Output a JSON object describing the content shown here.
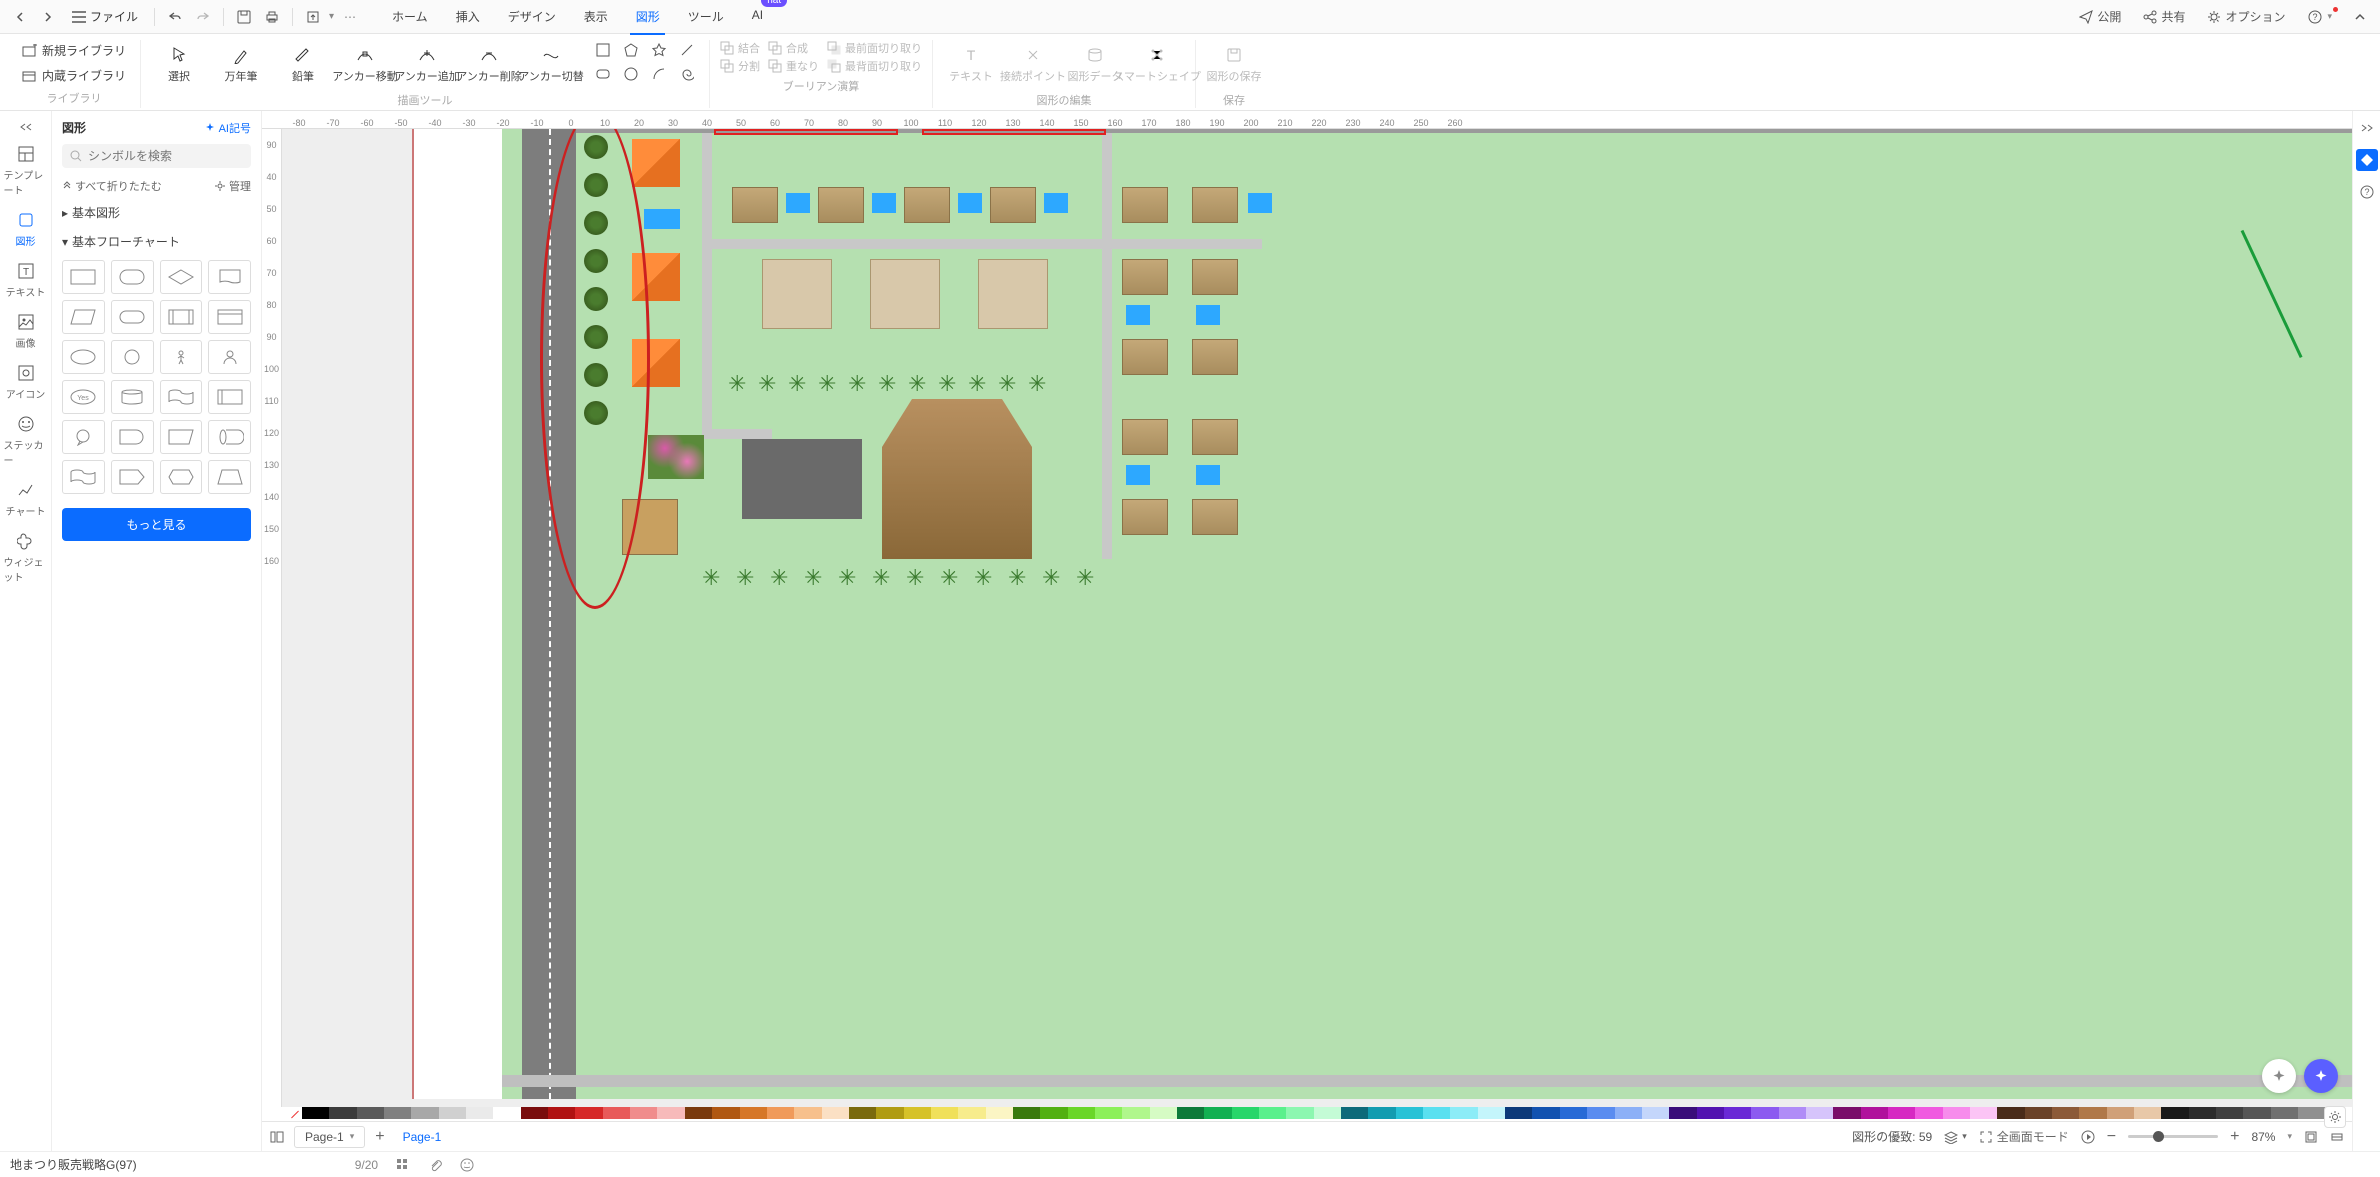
{
  "menubar": {
    "file": "ファイル",
    "items": [
      "ホーム",
      "挿入",
      "デザイン",
      "表示",
      "図形",
      "ツール",
      "AI"
    ],
    "active_index": 4,
    "hat_badge": "hat",
    "right": {
      "publish": "公開",
      "share": "共有",
      "options": "オプション"
    }
  },
  "ribbon": {
    "library": {
      "new": "新規ライブラリ",
      "builtin": "内蔵ライブラリ",
      "group_label": "ライブラリ"
    },
    "draw": {
      "select": "選択",
      "brush": "万年筆",
      "pencil": "鉛筆",
      "anchor_move": "アンカー移動",
      "anchor_add": "アンカー追加",
      "anchor_del": "アンカー削除",
      "anchor_toggle": "アンカー切替",
      "group_label": "描画ツール"
    },
    "boolean": {
      "union": "結合",
      "compose": "合成",
      "front_clip": "最前面切り取り",
      "split": "分割",
      "overlap": "重なり",
      "back_clip": "最背面切り取り",
      "group_label": "ブーリアン演算"
    },
    "edit": {
      "text": "テキスト",
      "connect": "接続ポイント",
      "data": "図形データ",
      "smart": "スマートシェイプ",
      "group_label": "図形の編集"
    },
    "save": {
      "save_shape": "図形の保存",
      "group_label": "保存"
    }
  },
  "left_rail": {
    "items": [
      {
        "label": "テンプレート"
      },
      {
        "label": "図形"
      },
      {
        "label": "テキスト"
      },
      {
        "label": "画像"
      },
      {
        "label": "アイコン"
      },
      {
        "label": "ステッカー"
      },
      {
        "label": "チャート"
      },
      {
        "label": "ウィジェット"
      }
    ],
    "active_index": 1
  },
  "shapes_panel": {
    "title": "図形",
    "ai_link": "AI記号",
    "search_placeholder": "シンボルを検索",
    "collapse_all": "すべて折りたたむ",
    "manage": "管理",
    "sections": {
      "basic_shapes": "基本図形",
      "basic_flow": "基本フローチャート"
    },
    "more": "もっと見る"
  },
  "ruler_h": [
    "-80",
    "-70",
    "-60",
    "-50",
    "-40",
    "-30",
    "-20",
    "-10",
    "0",
    "10",
    "20",
    "30",
    "40",
    "50",
    "60",
    "70",
    "80",
    "90",
    "100",
    "110",
    "120",
    "130",
    "140",
    "150",
    "160",
    "170",
    "180",
    "190",
    "200",
    "210",
    "220",
    "230",
    "240",
    "250",
    "260"
  ],
  "ruler_v": [
    "90",
    "40",
    "50",
    "60",
    "70",
    "80",
    "90",
    "100",
    "110",
    "120",
    "130",
    "140",
    "150",
    "160"
  ],
  "statusbar": {
    "page_dd": "Page-1",
    "page_tab": "Page-1",
    "priority_label": "図形の優致:",
    "priority_value": "59",
    "fullscreen": "全画面モード",
    "zoom_pct": "87%"
  },
  "footer": {
    "doc_name": "地まつり販売戦略G(97)",
    "counter": "9/20"
  },
  "palette": [
    "#000000",
    "#3b3b3b",
    "#5a5a5a",
    "#808080",
    "#a8a8a8",
    "#d0d0d0",
    "#eaeaea",
    "#ffffff",
    "#7a0d0d",
    "#b01212",
    "#d62828",
    "#e85a5a",
    "#f08c8c",
    "#f7baba",
    "#7a3a0d",
    "#b05812",
    "#d67728",
    "#f09a5a",
    "#f7c08c",
    "#fbe0c4",
    "#7a6a0d",
    "#b09c12",
    "#d6c228",
    "#f0e05a",
    "#f7ec8c",
    "#fbf5c4",
    "#3a7a0d",
    "#52b012",
    "#6ad628",
    "#8cf05a",
    "#b0f78c",
    "#d6fbc4",
    "#0d7a3a",
    "#12b052",
    "#28d66a",
    "#5af08c",
    "#8cf7b0",
    "#c4fbd6",
    "#0d6a7a",
    "#129cb0",
    "#28c2d6",
    "#5ae0f0",
    "#8cecf7",
    "#c4f5fb",
    "#0d3a7a",
    "#1252b0",
    "#286ad6",
    "#5a8cf0",
    "#8cb0f7",
    "#c4d6fb",
    "#3a0d7a",
    "#5212b0",
    "#6a28d6",
    "#8c5af0",
    "#b08cf7",
    "#d6c4fb",
    "#7a0d6a",
    "#b0129c",
    "#d628c2",
    "#f05ae0",
    "#f78cec",
    "#fbc4f5",
    "#4a2c1a",
    "#6a4228",
    "#8c5a38",
    "#b07848",
    "#d0a078",
    "#e8c8a8",
    "#1a1a1a",
    "#2c2c2c",
    "#404040",
    "#565656",
    "#707070",
    "#909090"
  ]
}
